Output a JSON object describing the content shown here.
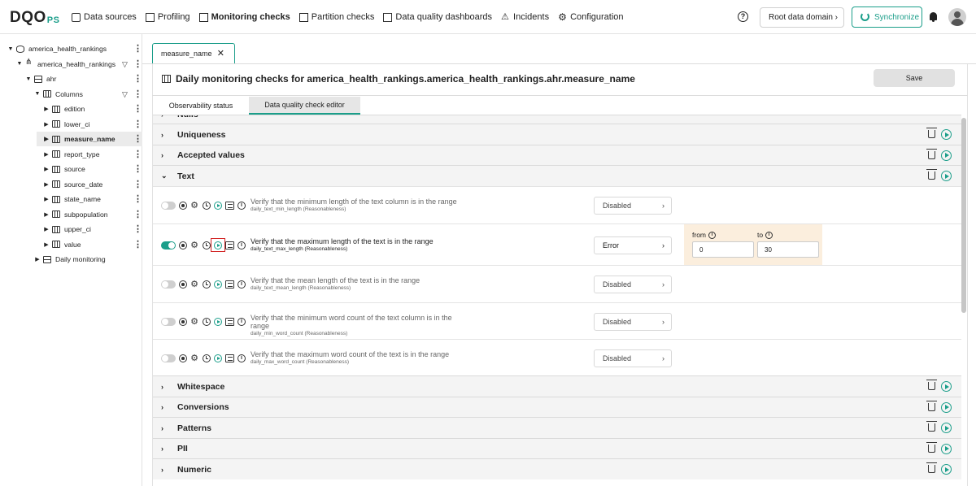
{
  "topbar": {
    "logo": "DQO",
    "logo_suffix": "PS",
    "nav": [
      {
        "label": "Data sources",
        "icon": "data-sources-icon",
        "active": false
      },
      {
        "label": "Profiling",
        "icon": "profiling-icon",
        "active": false
      },
      {
        "label": "Monitoring checks",
        "icon": "monitoring-icon",
        "active": true
      },
      {
        "label": "Partition checks",
        "icon": "partition-icon",
        "active": false
      },
      {
        "label": "Data quality dashboards",
        "icon": "dashboard-icon",
        "active": false
      },
      {
        "label": "Incidents",
        "icon": "warning-icon",
        "active": false
      },
      {
        "label": "Configuration",
        "icon": "gear-icon",
        "active": false
      }
    ],
    "domain_label": "Root data domain",
    "sync_label": "Synchronize",
    "accent_color": "#1b9e8a"
  },
  "sidebar": {
    "items": [
      {
        "label": "america_health_rankings",
        "level": 0,
        "expanded": true,
        "icon": "database-icon"
      },
      {
        "label": "america_health_rankings",
        "level": 1,
        "expanded": true,
        "icon": "schema-icon"
      },
      {
        "label": "ahr",
        "level": 2,
        "expanded": true,
        "icon": "table-icon"
      },
      {
        "label": "Columns",
        "level": 3,
        "expanded": true,
        "icon": "columns-icon"
      },
      {
        "label": "edition",
        "level": 4,
        "expanded": false,
        "icon": "column-icon"
      },
      {
        "label": "lower_ci",
        "level": 4,
        "expanded": false,
        "icon": "column-icon"
      },
      {
        "label": "measure_name",
        "level": 4,
        "expanded": false,
        "icon": "column-icon",
        "selected": true
      },
      {
        "label": "report_type",
        "level": 4,
        "expanded": false,
        "icon": "column-icon"
      },
      {
        "label": "source",
        "level": 4,
        "expanded": false,
        "icon": "column-icon"
      },
      {
        "label": "source_date",
        "level": 4,
        "expanded": false,
        "icon": "column-icon"
      },
      {
        "label": "state_name",
        "level": 4,
        "expanded": false,
        "icon": "column-icon"
      },
      {
        "label": "subpopulation",
        "level": 4,
        "expanded": false,
        "icon": "column-icon"
      },
      {
        "label": "upper_ci",
        "level": 4,
        "expanded": false,
        "icon": "column-icon"
      },
      {
        "label": "value",
        "level": 4,
        "expanded": false,
        "icon": "column-icon"
      },
      {
        "label": "Daily monitoring",
        "level": 3,
        "expanded": false,
        "icon": "calendar-icon"
      }
    ]
  },
  "main": {
    "open_tab": "measure_name",
    "title": "Daily monitoring checks for america_health_rankings.america_health_rankings.ahr.measure_name",
    "save_label": "Save",
    "subtabs": [
      "Observability status",
      "Data quality check editor"
    ],
    "active_subtab": 1,
    "partial_category": "Nulls",
    "categories_top": [
      "Uniqueness",
      "Accepted values"
    ],
    "expanded_category": "Text",
    "checks": [
      {
        "description": "Verify that the minimum length of the text column is in the range",
        "name": "daily_text_min_length (Reasonableness)",
        "enabled": false,
        "severity": "Disabled"
      },
      {
        "description": "Verify that the maximum length of the text is in the range",
        "name": "daily_text_max_length (Reasonableness)",
        "enabled": true,
        "severity": "Error",
        "rule": {
          "from_label": "from",
          "from_value": "0",
          "to_label": "to",
          "to_value": "30"
        }
      },
      {
        "description": "Verify that the mean length of the text is in the range",
        "name": "daily_text_mean_length (Reasonableness)",
        "enabled": false,
        "severity": "Disabled"
      },
      {
        "description": "Verify that the minimum word count of the text column is in the range",
        "name": "daily_min_word_count (Reasonableness)",
        "enabled": false,
        "severity": "Disabled"
      },
      {
        "description": "Verify that the maximum word count of the text is in the range",
        "name": "daily_max_word_count (Reasonableness)",
        "enabled": false,
        "severity": "Disabled"
      }
    ],
    "categories_bottom": [
      "Whitespace",
      "Conversions",
      "Patterns",
      "PII",
      "Numeric"
    ]
  }
}
